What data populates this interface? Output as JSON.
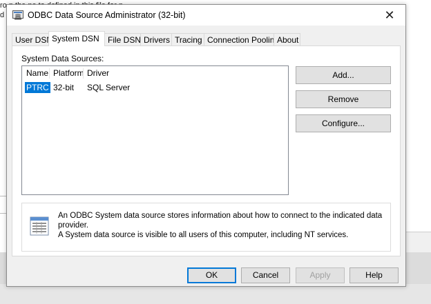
{
  "background": {
    "line1": "ro                      n the                       ne  ta    defined in this file   for    n  ",
    "line2": "d"
  },
  "window": {
    "title": "ODBC Data Source Administrator (32-bit)",
    "close_glyph": "✕"
  },
  "tabs": [
    {
      "label": "User DSN",
      "active": false
    },
    {
      "label": "System DSN",
      "active": true
    },
    {
      "label": "File DSN",
      "active": false
    },
    {
      "label": "Drivers",
      "active": false
    },
    {
      "label": "Tracing",
      "active": false
    },
    {
      "label": "Connection Pooling",
      "active": false
    },
    {
      "label": "About",
      "active": false
    }
  ],
  "system_dsn": {
    "section_label": "System Data Sources:",
    "columns": [
      "Name",
      "Platform",
      "Driver"
    ],
    "rows": [
      {
        "name": "PTRC",
        "platform": "32-bit",
        "driver": "SQL Server",
        "selected": true
      }
    ],
    "buttons": {
      "add": "Add...",
      "remove": "Remove",
      "configure": "Configure..."
    },
    "info_text_line1": "An ODBC System data source stores information about how to connect to the indicated data provider.",
    "info_text_line2": "A System data source is visible to all users of this computer, including NT services."
  },
  "footer_buttons": {
    "ok": "OK",
    "cancel": "Cancel",
    "apply": "Apply",
    "help": "Help"
  },
  "colors": {
    "selection": "#0078d7",
    "button_face": "#e1e1e1",
    "dialog_bg": "#f0f0f0"
  },
  "icons": {
    "title": "odbc-window-icon",
    "info": "data-source-list-icon",
    "close": "close-icon"
  }
}
